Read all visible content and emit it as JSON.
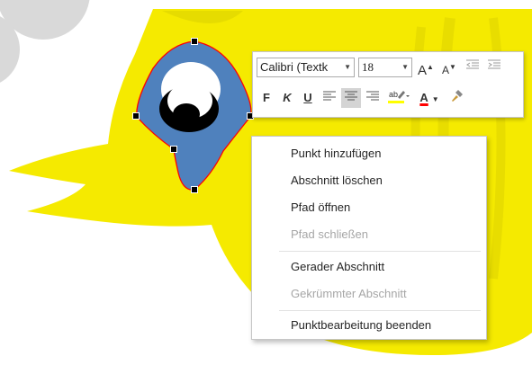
{
  "mini_toolbar": {
    "font_name": "Calibri (Textk",
    "font_size": "18",
    "grow_font_label": "A",
    "shrink_font_label": "A",
    "bold_label": "F",
    "italic_label": "K",
    "underline_label": "U",
    "font_color_label": "A",
    "highlight_color": "#ffff00",
    "font_color": "#ff0000"
  },
  "context_menu": {
    "items": [
      {
        "label": "Punkt hinzufügen",
        "enabled": true
      },
      {
        "label": "Abschnitt löschen",
        "enabled": true
      },
      {
        "label": "Pfad öffnen",
        "enabled": true
      },
      {
        "label": "Pfad schließen",
        "enabled": false
      },
      {
        "label": "Gerader Abschnitt",
        "enabled": true
      },
      {
        "label": "Gekrümmter Abschnitt",
        "enabled": false
      },
      {
        "label": "Punktbearbeitung beenden",
        "enabled": true
      }
    ]
  },
  "colors": {
    "body_yellow": "#f5ea00",
    "body_shadow": "#e6dc00",
    "eye_blue": "#4f81bd",
    "selection_outline": "#ff0000",
    "gray_circle": "#d9d9d9"
  }
}
